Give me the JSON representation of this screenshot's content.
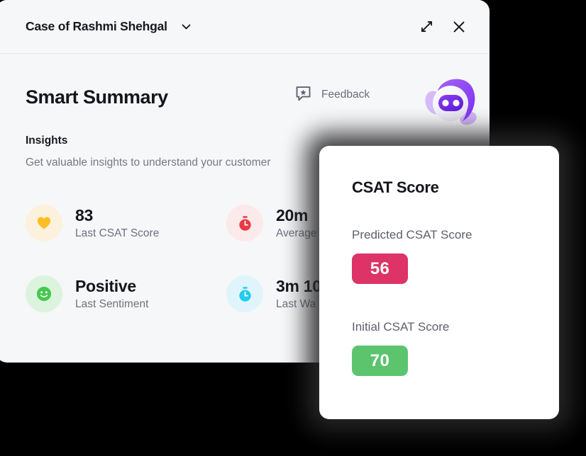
{
  "window": {
    "background_color": "#000000",
    "panel_background": "#f6f7f9"
  },
  "header": {
    "case_title": "Case of Rashmi Shehgal",
    "dropdown_icon": "chevron-down-icon",
    "expand_icon": "expand-diagonal-icon",
    "close_icon": "close-x-icon"
  },
  "summary": {
    "heading": "Smart Summary",
    "feedback_label": "Feedback",
    "feedback_icon": "speech-bubble-star-icon",
    "mascot_icon": "ai-bot-mascot-icon",
    "insights_heading": "Insights",
    "insights_subtitle": "Get valuable insights to understand your customer",
    "metrics": [
      {
        "icon": "heart-icon",
        "icon_color": "#fbbf24",
        "circle_color": "#fcf1dc",
        "value": "83",
        "label": "Last CSAT Score"
      },
      {
        "icon": "stopwatch-icon",
        "icon_color": "#e83a45",
        "circle_color": "#fce9ea",
        "value": "20m",
        "label": "Average"
      },
      {
        "icon": "smiley-face-icon",
        "icon_color": "#45c94f",
        "circle_color": "#dcf3dd",
        "value": "Positive",
        "label": "Last Sentiment"
      },
      {
        "icon": "stopwatch-icon",
        "icon_color": "#22ccee",
        "circle_color": "#dff5fb",
        "value": "3m 10",
        "label": "Last Wa"
      }
    ]
  },
  "csat_card": {
    "title": "CSAT Score",
    "predicted_label": "Predicted CSAT Score",
    "predicted_value": "56",
    "predicted_color": "#dd3366",
    "initial_label": "Initial CSAT Score",
    "initial_value": "70",
    "initial_color": "#5cc46d"
  }
}
